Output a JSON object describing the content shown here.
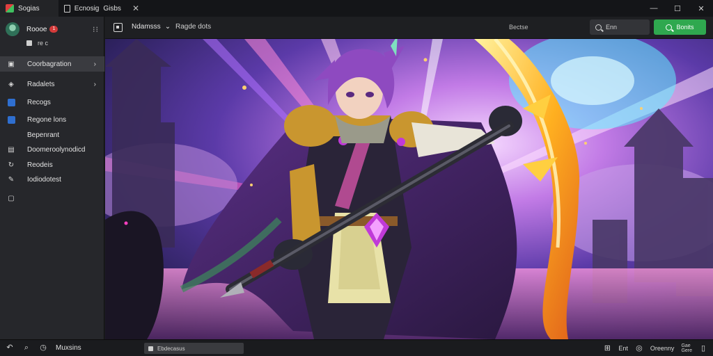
{
  "titlebar": {
    "tabs": [
      {
        "label": "Sogias"
      },
      {
        "label": "Ecnosig",
        "sub": "Gisbs"
      }
    ],
    "window_controls": [
      "minimize",
      "maximize",
      "close"
    ]
  },
  "sidebar": {
    "profile": {
      "name": "Roooe",
      "badge": "1"
    },
    "subrow": {
      "text": "re  c"
    },
    "items": [
      {
        "label": "Coorbagration",
        "icon": "dashboard-icon",
        "chevron": true
      },
      {
        "label": "Radalets",
        "icon": "layers-icon",
        "chevron": true
      },
      {
        "label": "Recogs",
        "icon": "blue-square-icon"
      },
      {
        "label": "Regone lons",
        "icon": "blue-square-icon"
      },
      {
        "label": "Bepenrant",
        "icon": ""
      },
      {
        "label": "Doomeroolynodicd",
        "icon": "image-icon"
      },
      {
        "label": "Reodeis",
        "icon": "refresh-icon"
      },
      {
        "label": "Iodiodotest",
        "icon": "pin-icon"
      },
      {
        "label": "",
        "icon": "chat-icon"
      }
    ]
  },
  "toolbar": {
    "dropdown_label": "Ndamsss",
    "sub_label": "Ragde dots",
    "center_label": "Bectse",
    "search_label": "Enn",
    "primary_button": "Bonits"
  },
  "bottombar": {
    "label": "Muxsins",
    "field_value": "Ebdecasus",
    "right_label_1": "Ent",
    "right_label_2": "Oreenny",
    "stack_top": "Gae",
    "stack_bottom": "Gere"
  },
  "colors": {
    "accent_green": "#2fa84f",
    "badge_red": "#d33a3a",
    "sidebar_bg": "#26272b",
    "titlebar_bg": "#141518"
  }
}
